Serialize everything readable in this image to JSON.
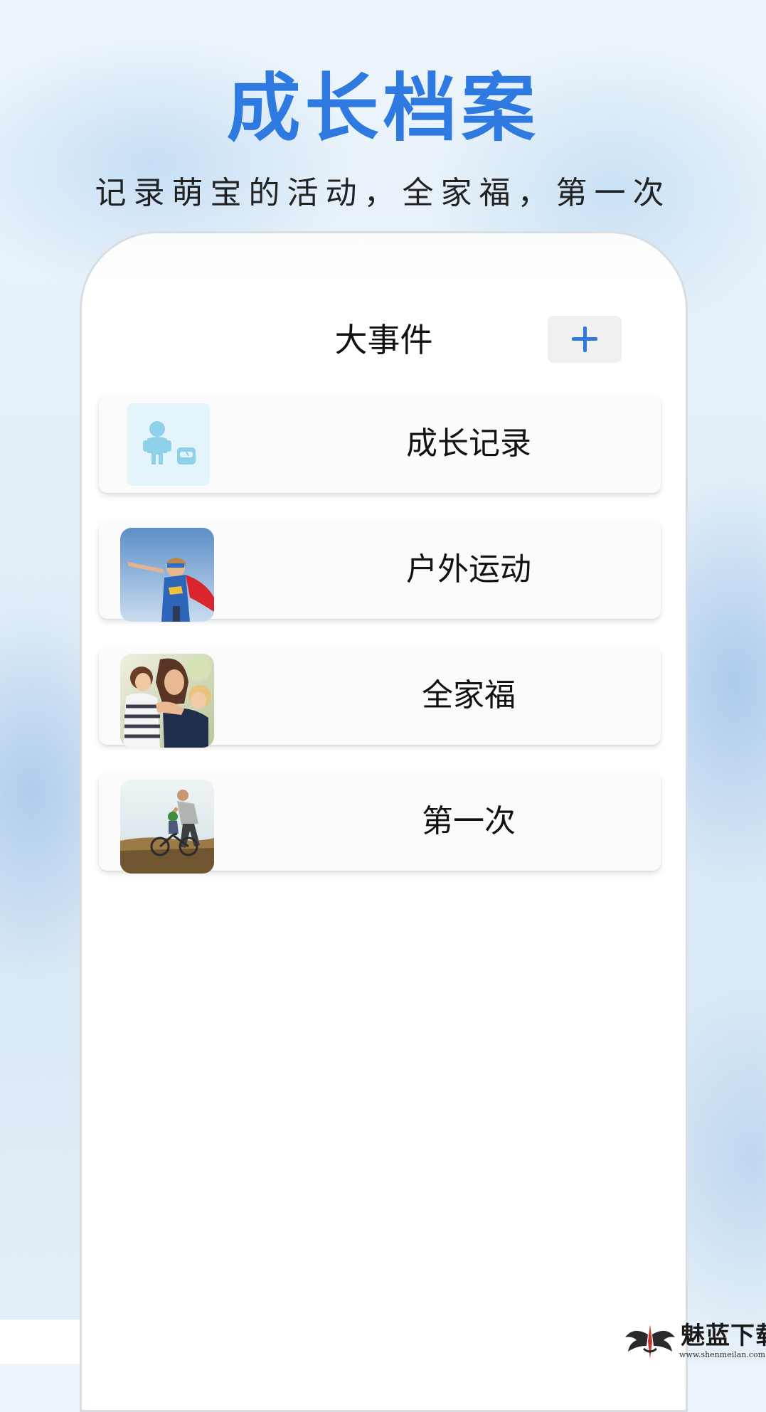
{
  "hero": {
    "title": "成长档案",
    "subtitle": "记录萌宝的活动，全家福，第一次"
  },
  "app": {
    "header_title": "大事件",
    "add_button_icon": "plus-icon"
  },
  "events": [
    {
      "label": "成长记录",
      "thumbnail": "growth-record-icon"
    },
    {
      "label": "户外运动",
      "thumbnail": "outdoor-sport-photo"
    },
    {
      "label": "全家福",
      "thumbnail": "family-photo"
    },
    {
      "label": "第一次",
      "thumbnail": "first-time-photo"
    }
  ],
  "watermark": {
    "brand": "魅蓝下载",
    "url": "www.shenmeilan.com"
  },
  "colors": {
    "accent": "#2f7ae0",
    "card_bg": "#fbfbfb",
    "growth_icon_bg": "#e4f4fb",
    "growth_icon_fg": "#8fd0ea"
  }
}
